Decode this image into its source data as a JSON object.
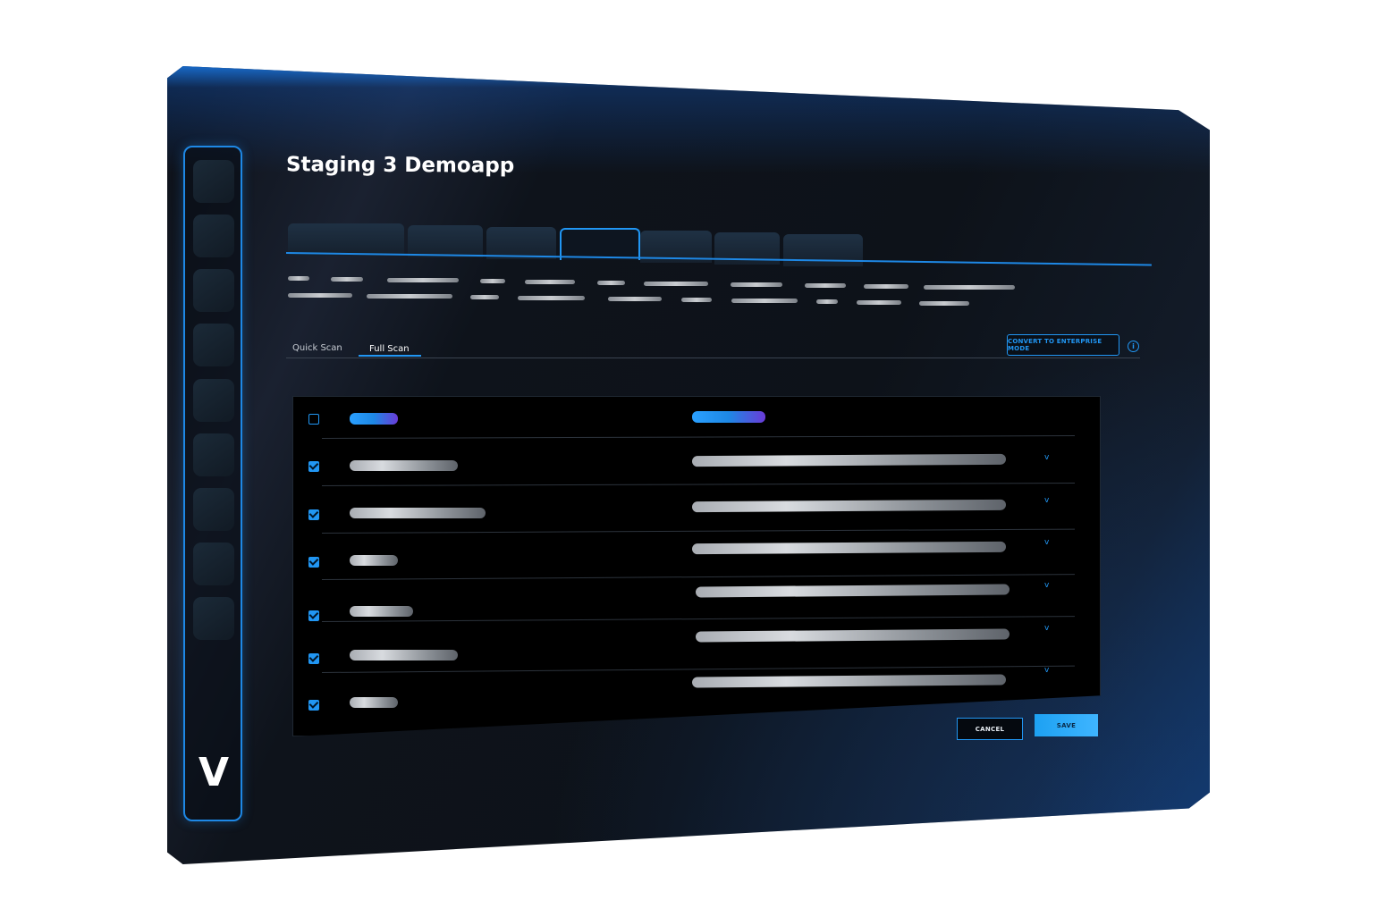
{
  "app": {
    "title": "Staging 3 Demoapp",
    "logo_text": "V"
  },
  "scan_tabs": [
    {
      "label": "Quick Scan",
      "active": false
    },
    {
      "label": "Full Scan",
      "active": true
    }
  ],
  "convert_button": {
    "label": "CONVERT TO ENTERPRISE MODE"
  },
  "info_icon": {
    "glyph": "i"
  },
  "table": {
    "header_checked": false,
    "rows": [
      {
        "checked": true
      },
      {
        "checked": true
      },
      {
        "checked": true
      },
      {
        "checked": true
      },
      {
        "checked": true
      },
      {
        "checked": true
      }
    ]
  },
  "buttons": {
    "cancel_label": "CANCEL",
    "save_label": "SAVE"
  },
  "colors": {
    "accent": "#2196f3",
    "background": "#0d1219",
    "panel": "#000000"
  }
}
